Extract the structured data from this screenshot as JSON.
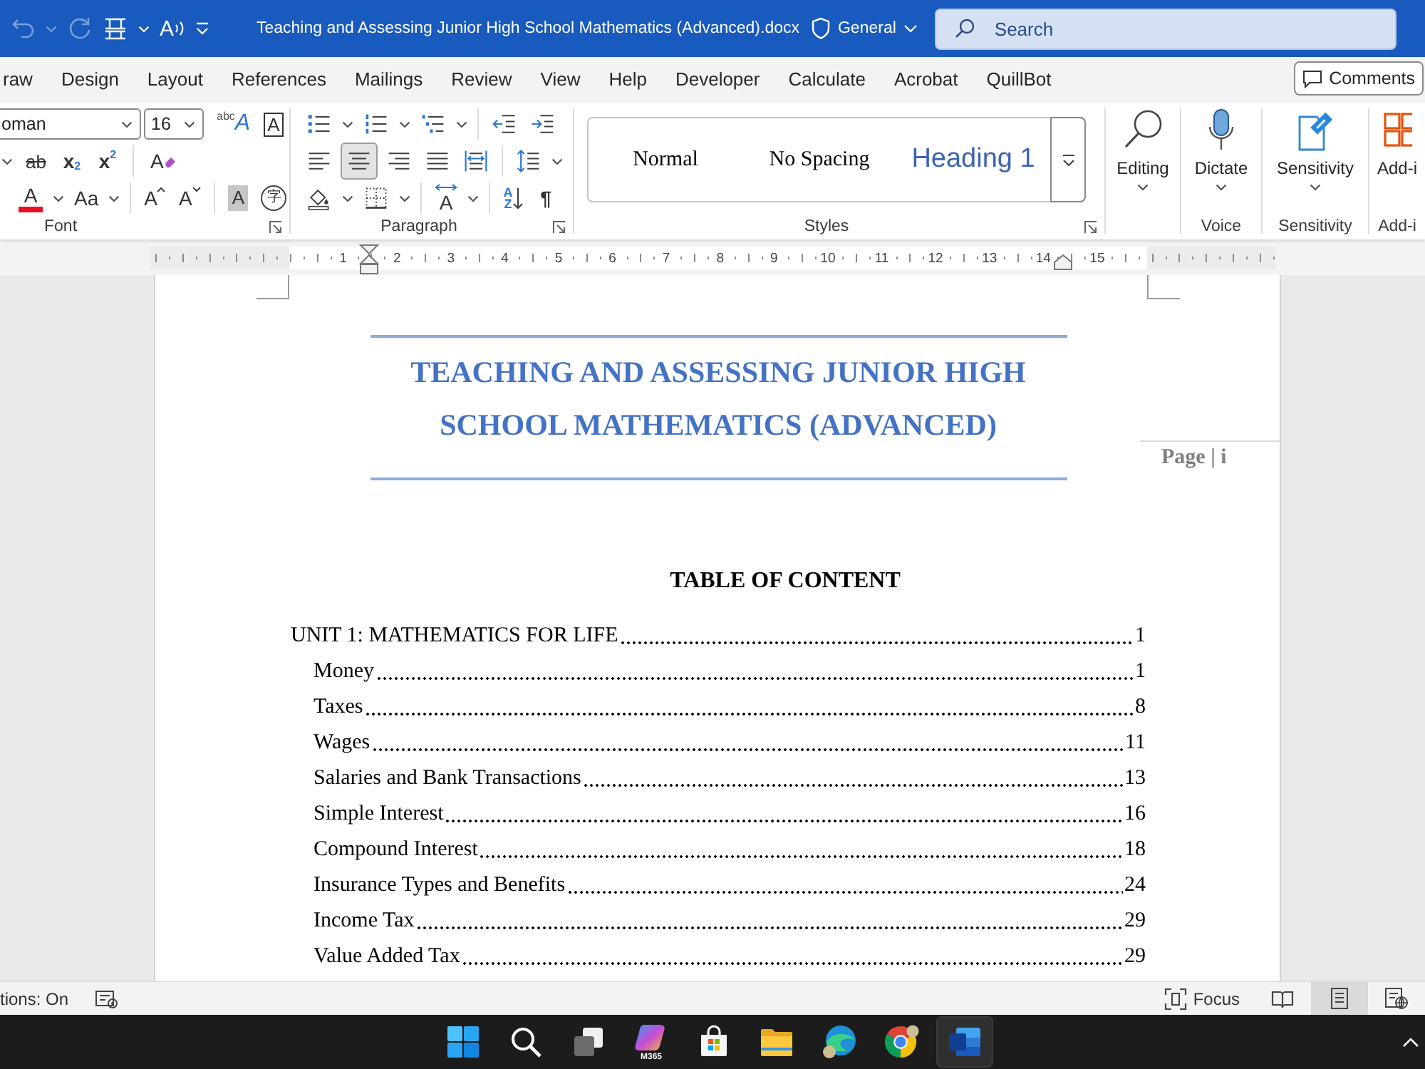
{
  "title_bar": {
    "quick_access": [
      {
        "kind": "undo",
        "disabled": true
      },
      {
        "kind": "caret",
        "disabled": true
      },
      {
        "kind": "redo",
        "disabled": true
      },
      {
        "kind": "grid",
        "disabled": false
      },
      {
        "kind": "caret",
        "disabled": false
      },
      {
        "kind": "read-aloud",
        "glyph": "A",
        "disabled": false
      },
      {
        "kind": "customize",
        "disabled": false
      }
    ],
    "document_title": "Teaching and Assessing Junior High School Mathematics (Advanced).docx",
    "sensitivity": "General",
    "search": {
      "placeholder": "Search"
    }
  },
  "ribbon_tabs": [
    {
      "label": "raw",
      "selected": false
    },
    {
      "label": "Design",
      "selected": false
    },
    {
      "label": "Layout",
      "selected": false
    },
    {
      "label": "References",
      "selected": false
    },
    {
      "label": "Mailings",
      "selected": false
    },
    {
      "label": "Review",
      "selected": false
    },
    {
      "label": "View",
      "selected": false
    },
    {
      "label": "Help",
      "selected": false
    },
    {
      "label": "Developer",
      "selected": false
    },
    {
      "label": "Calculate",
      "selected": false
    },
    {
      "label": "Acrobat",
      "selected": false
    },
    {
      "label": "QuillBot",
      "selected": false
    }
  ],
  "comments_button": "Comments",
  "ribbon": {
    "font": {
      "label": "Font",
      "font_name": "oman",
      "font_size": "16",
      "top_tools": [
        {
          "kind": "text-effects",
          "glyph": "A",
          "small": "abc"
        },
        {
          "kind": "char-border",
          "glyph": "A"
        }
      ],
      "middle_tools": [
        {
          "kind": "caret"
        },
        {
          "kind": "strikethrough",
          "glyph": "ab"
        },
        {
          "kind": "subscript",
          "glyph": "x",
          "small": "2"
        },
        {
          "kind": "superscript",
          "glyph": "x",
          "small": "2"
        },
        {
          "kind": "separator"
        },
        {
          "kind": "clear-format",
          "glyph": "A"
        }
      ],
      "bottom_tools": [
        {
          "kind": "font-color",
          "glyph": "A"
        },
        {
          "kind": "caret"
        },
        {
          "kind": "change-case",
          "glyph": "Aa"
        },
        {
          "kind": "caret"
        },
        {
          "kind": "separator"
        },
        {
          "kind": "grow",
          "glyph": "A"
        },
        {
          "kind": "shrink",
          "glyph": "A"
        },
        {
          "kind": "separator"
        },
        {
          "kind": "char-shading",
          "glyph": "A"
        },
        {
          "kind": "enclose",
          "glyph": "字"
        }
      ]
    },
    "paragraph": {
      "label": "Paragraph",
      "top_tools": [
        {
          "kind": "bullets"
        },
        {
          "kind": "caret"
        },
        {
          "kind": "numbering"
        },
        {
          "kind": "caret"
        },
        {
          "kind": "multilevel"
        },
        {
          "kind": "caret"
        },
        {
          "kind": "separator"
        },
        {
          "kind": "outdent"
        },
        {
          "kind": "indent"
        }
      ],
      "middle_tools": [
        {
          "kind": "align-left",
          "selected": false
        },
        {
          "kind": "align-center",
          "selected": true
        },
        {
          "kind": "align-right",
          "selected": false
        },
        {
          "kind": "justify",
          "selected": false
        },
        {
          "kind": "distribute",
          "selected": false
        },
        {
          "kind": "separator"
        },
        {
          "kind": "line-spacing"
        },
        {
          "kind": "caret"
        }
      ],
      "bottom_tools": [
        {
          "kind": "shading"
        },
        {
          "kind": "caret"
        },
        {
          "kind": "borders"
        },
        {
          "kind": "caret"
        },
        {
          "kind": "separator"
        },
        {
          "kind": "text-spacing",
          "glyph": "A"
        },
        {
          "kind": "caret"
        },
        {
          "kind": "separator"
        },
        {
          "kind": "sort",
          "glyph": "AZ"
        },
        {
          "kind": "pilcrow",
          "glyph": "¶"
        }
      ]
    },
    "styles": {
      "label": "Styles",
      "items": [
        {
          "name": "Normal",
          "kind": "normal",
          "selected": false
        },
        {
          "name": "No Spacing",
          "kind": "no-spacing",
          "selected": false
        },
        {
          "name": "Heading 1",
          "kind": "heading",
          "selected": false
        }
      ]
    },
    "commands": [
      {
        "kind": "editing",
        "button": "Editing"
      },
      {
        "kind": "voice",
        "button": "Dictate",
        "label": "Voice"
      },
      {
        "kind": "sensitivity",
        "button": "Sensitivity",
        "label": "Sensitivity"
      },
      {
        "kind": "add-ins",
        "button": "Add-i",
        "label": "Add-i"
      }
    ]
  },
  "ruler": {
    "numbers": [
      "1",
      "2",
      "3",
      "4",
      "5",
      "6",
      "7",
      "8",
      "9",
      "10",
      "11",
      "12",
      "13",
      "14",
      "15"
    ]
  },
  "document": {
    "header": {
      "title": "TEACHING AND ASSESSING JUNIOR HIGH SCHOOL MATHEMATICS (ADVANCED)",
      "page_label": "Page | i"
    },
    "toc": {
      "heading": "TABLE OF CONTENT",
      "entries": [
        {
          "title": "UNIT 1: MATHEMATICS FOR LIFE",
          "page": "1",
          "children": [
            {
              "title": "Money",
              "page": "1"
            },
            {
              "title": "Taxes",
              "page": "8"
            },
            {
              "title": "Wages",
              "page": "11"
            },
            {
              "title": "Salaries and Bank Transactions",
              "page": "13"
            },
            {
              "title": "Simple Interest",
              "page": "16"
            },
            {
              "title": "Compound Interest",
              "page": "18"
            },
            {
              "title": "Insurance Types and Benefits",
              "page": "24"
            },
            {
              "title": "Income Tax",
              "page": "29"
            },
            {
              "title": "Value Added Tax",
              "page": "29"
            }
          ]
        }
      ]
    }
  },
  "status_bar": {
    "text": "tions: On",
    "focus": "Focus",
    "views": [
      {
        "kind": "read",
        "selected": false
      },
      {
        "kind": "print",
        "selected": true
      },
      {
        "kind": "web",
        "selected": false
      }
    ]
  },
  "taskbar": {
    "apps": [
      {
        "kind": "start",
        "selected": false
      },
      {
        "kind": "search",
        "selected": false
      },
      {
        "kind": "task-view",
        "selected": false
      },
      {
        "kind": "m365",
        "badge": "M365",
        "selected": false
      },
      {
        "kind": "store",
        "selected": false
      },
      {
        "kind": "explorer",
        "selected": false
      },
      {
        "kind": "edge",
        "selected": false
      },
      {
        "kind": "chrome",
        "selected": false
      },
      {
        "kind": "word",
        "selected": true
      }
    ]
  }
}
